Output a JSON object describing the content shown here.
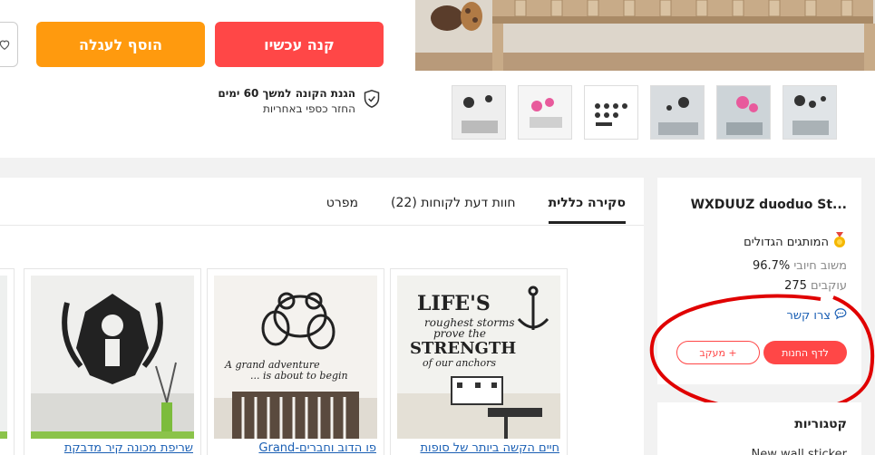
{
  "buttons": {
    "buy_now": "קנה עכשיו",
    "add_to_cart": "הוסף לעגלה"
  },
  "guarantee": {
    "title": "הגנת הקונה למשך 60 ימים",
    "subtitle": "החזר כספי באחריות"
  },
  "tabs": [
    {
      "label": "סקירה כללית",
      "active": true
    },
    {
      "label": "חוות דעת לקוחות (22)",
      "active": false
    },
    {
      "label": "מפרט",
      "active": false
    }
  ],
  "recommended": [
    {
      "title": "חיים הקשה ביותר של סופות"
    },
    {
      "title": "פו הדוב וחברים-Grand"
    },
    {
      "title": "שריפת מכונה קיר מדבקת"
    }
  ],
  "store": {
    "name": "WXDUUZ duoduo St...",
    "badge": "המותגים הגדולים",
    "feedback_label": "משוב חיובי",
    "feedback_value": "96.7%",
    "followers_label": "עוקבים",
    "followers_value": "275",
    "contact": "צרו קשר",
    "visit": "לדף החנות",
    "follow": "+ מעקב"
  },
  "categories": {
    "title": "קטגוריות",
    "first_item": "New wall sticker"
  },
  "colors": {
    "accent_red": "#ff4747",
    "accent_orange": "#ff9a0e",
    "link_blue": "#1a5fb4"
  }
}
